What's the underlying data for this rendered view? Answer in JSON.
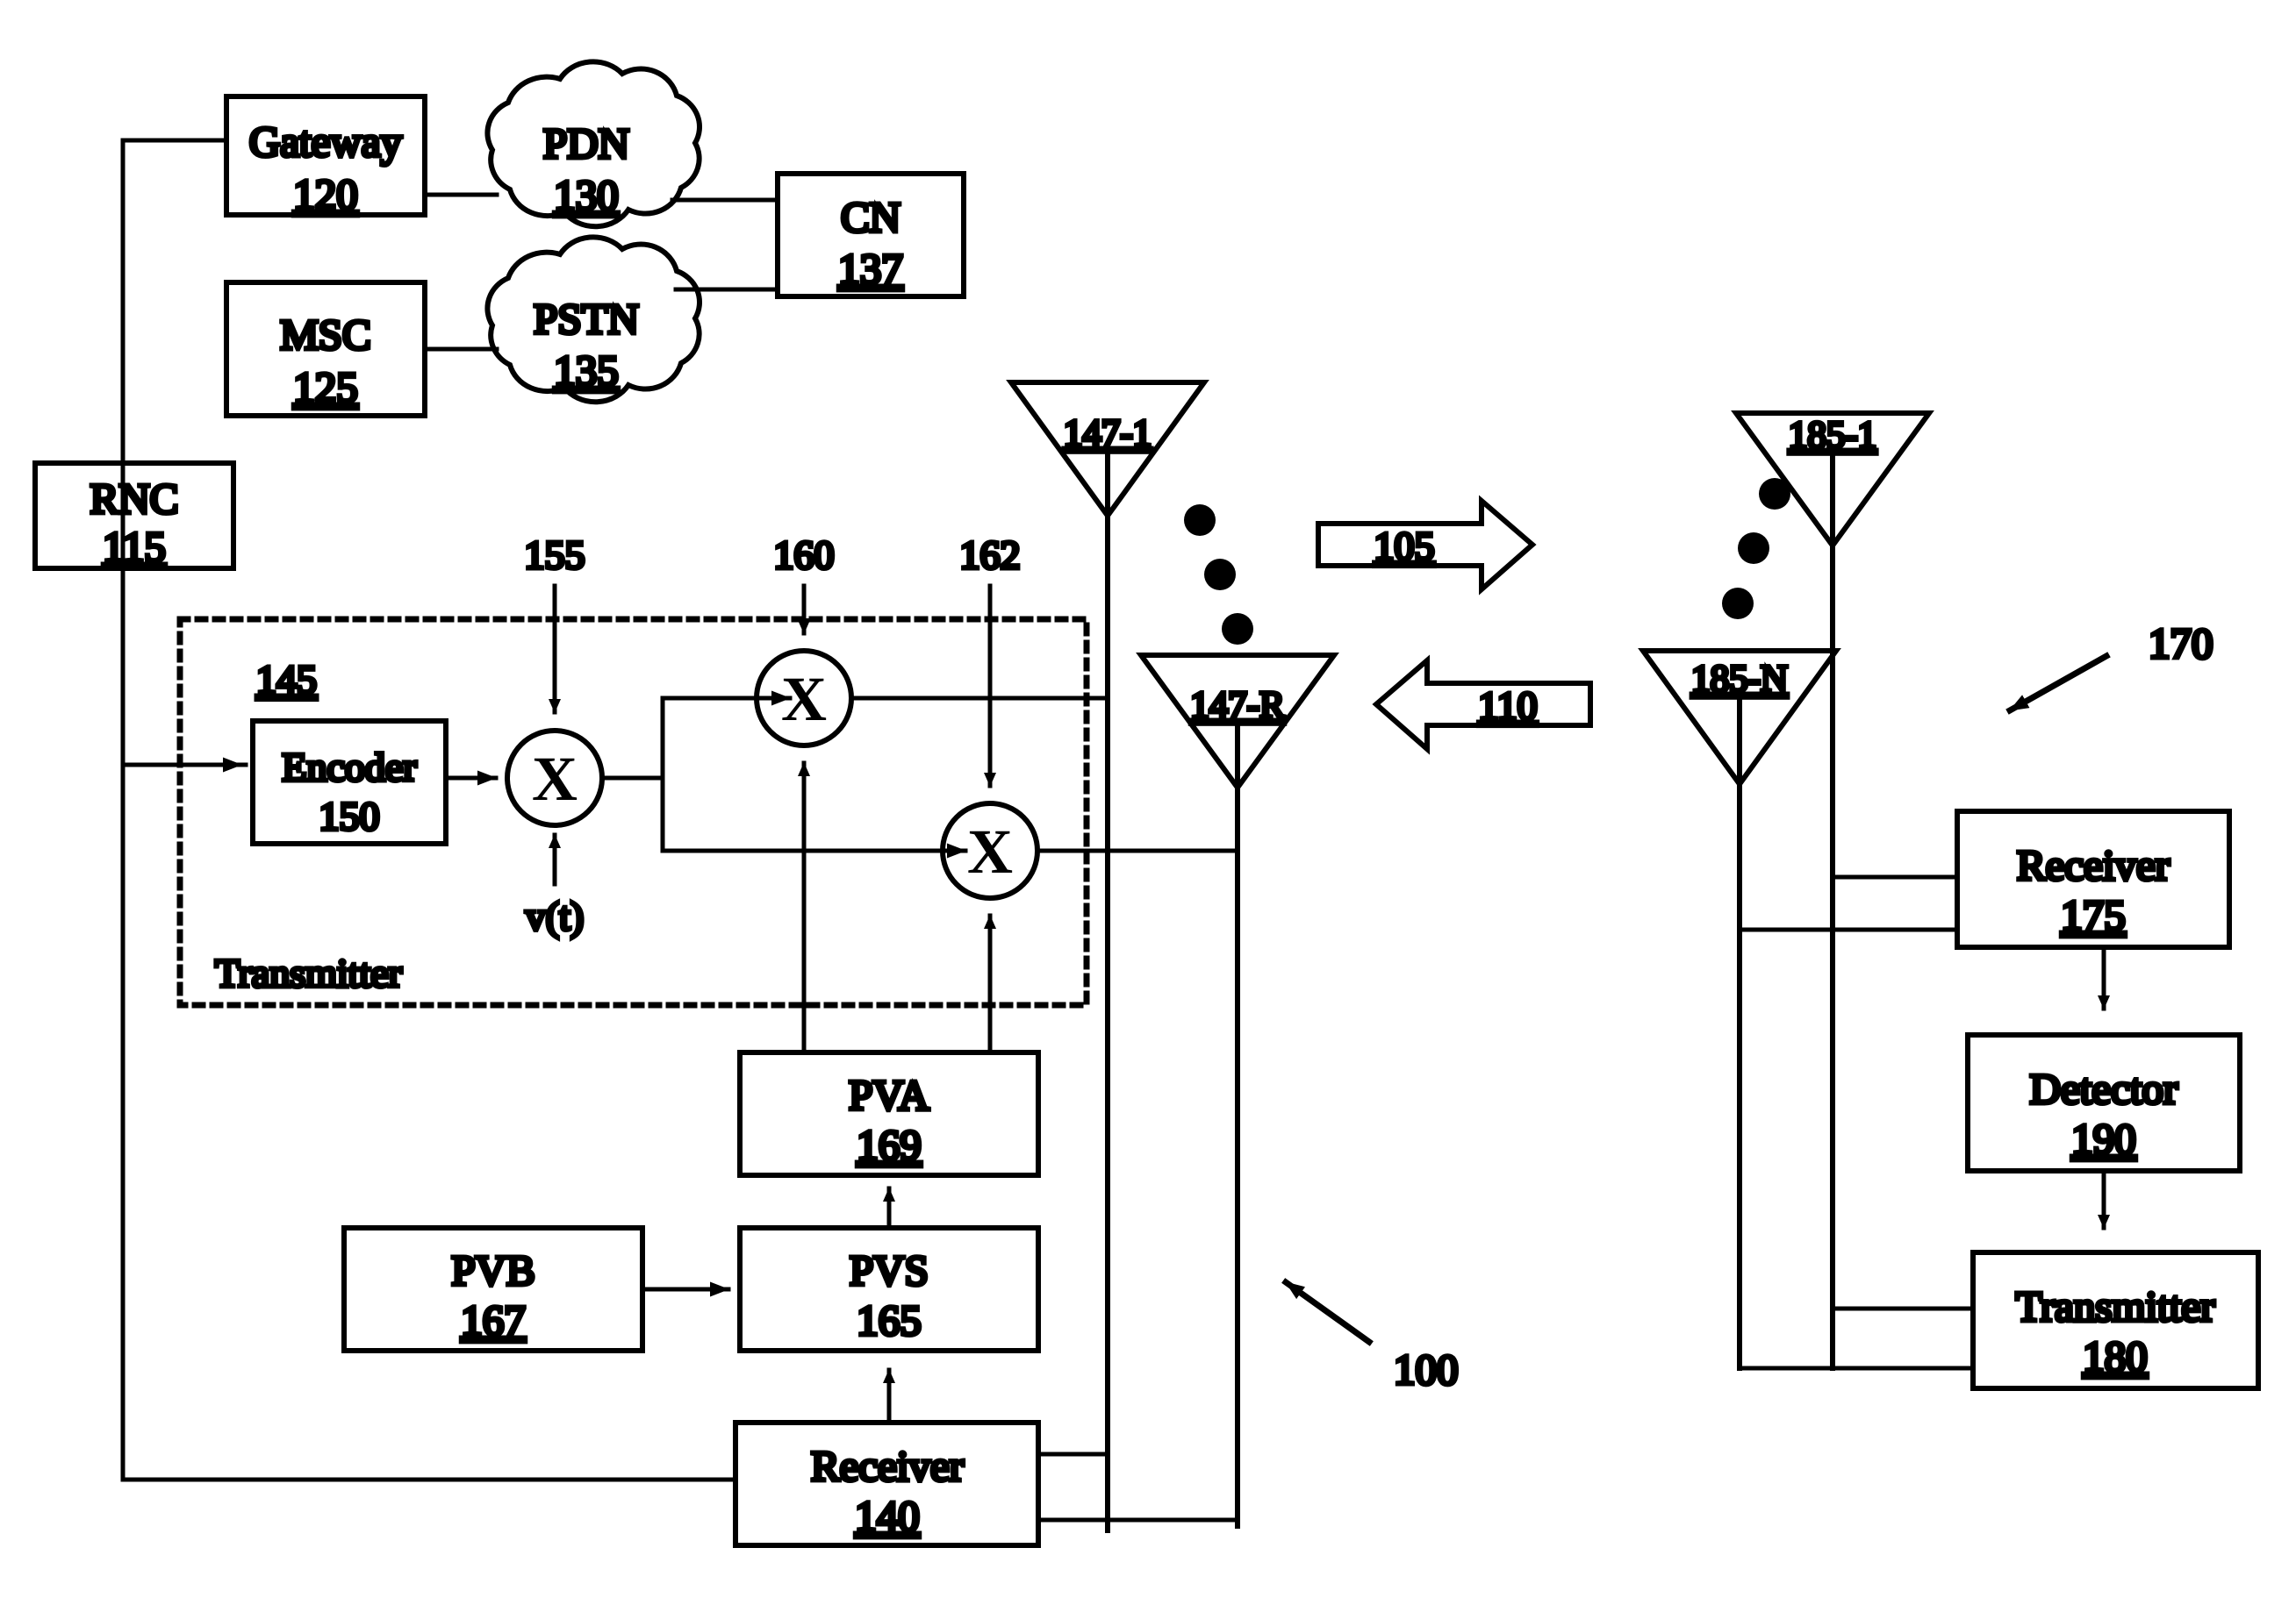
{
  "figure": {
    "title": "Wireless communication system block diagram",
    "overall_ref": "100",
    "remote_group_ref": "170",
    "stroke_color": "#000000",
    "background_color": "#ffffff"
  },
  "network_nodes": {
    "gateway": {
      "name": "Gateway",
      "ref": "120"
    },
    "msc": {
      "name": "MSC",
      "ref": "125"
    },
    "pdn": {
      "name": "PDN",
      "ref": "130"
    },
    "pstn": {
      "name": "PSTN",
      "ref": "135"
    },
    "cn": {
      "name": "CN",
      "ref": "137"
    },
    "rnc": {
      "name": "RNC",
      "ref": "115"
    }
  },
  "transmitter_block": {
    "boundary_label": "Transmitter",
    "encoder_group_ref": "145",
    "encoder": {
      "name": "Encoder",
      "ref": "150"
    },
    "mixer_spread": {
      "symbol": "X",
      "ref": "155",
      "second_input": "v(t)"
    },
    "mixer_upper": {
      "symbol": "X",
      "ref": "160"
    },
    "mixer_lower": {
      "symbol": "X",
      "ref": "162"
    }
  },
  "base_station_blocks": {
    "pva": {
      "name": "PVA",
      "ref": "169"
    },
    "pvb": {
      "name": "PVB",
      "ref": "167"
    },
    "pvs": {
      "name": "PVS",
      "ref": "165"
    },
    "receiver": {
      "name": "Receiver",
      "ref": "140"
    }
  },
  "base_station_antennas": [
    {
      "label": "147-1"
    },
    {
      "label": "147-R"
    }
  ],
  "remote_antennas": [
    {
      "label": "185-1"
    },
    {
      "label": "185-N"
    }
  ],
  "remote_blocks": {
    "receiver": {
      "name": "Receiver",
      "ref": "175"
    },
    "detector": {
      "name": "Detector",
      "ref": "190"
    },
    "transmitter": {
      "name": "Transmitter",
      "ref": "180"
    }
  },
  "link_arrows": {
    "forward": {
      "ref": "105",
      "direction": "right"
    },
    "reverse": {
      "ref": "110",
      "direction": "left"
    }
  },
  "ellipsis": {
    "glyph": "●",
    "count_per_group": 3
  }
}
